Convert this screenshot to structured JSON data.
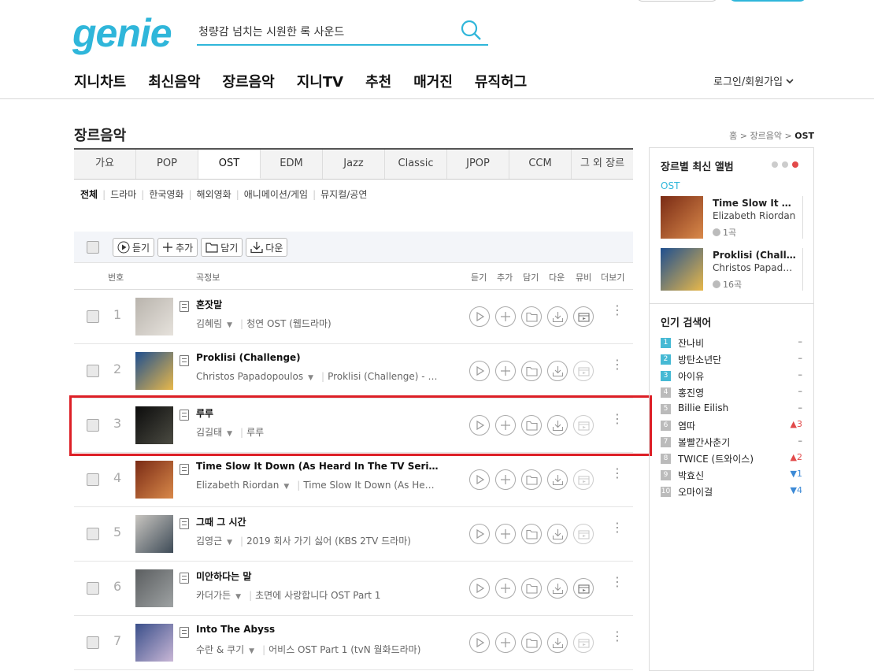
{
  "logo": "genie",
  "search": {
    "value": "청량감 넘치는 시원한 록 사운드"
  },
  "nav": [
    "지니차트",
    "최신음악",
    "장르음악",
    "지니TV",
    "추천",
    "매거진",
    "뮤직허그"
  ],
  "login": "로그인/회원가입",
  "page_title": "장르음악",
  "breadcrumb": {
    "home": "홈",
    "mid": "장르음악",
    "current": "OST"
  },
  "genre_tabs": [
    "가요",
    "POP",
    "OST",
    "EDM",
    "Jazz",
    "Classic",
    "JPOP",
    "CCM",
    "그 외 장르"
  ],
  "active_tab": "OST",
  "subtabs": [
    "전체",
    "드라마",
    "한국영화",
    "해외영화",
    "애니메이션/게임",
    "뮤지컬/공연"
  ],
  "toolbar": {
    "play": "듣기",
    "add": "추가",
    "save": "담기",
    "download": "다운"
  },
  "columns": {
    "num": "번호",
    "info": "곡정보",
    "play": "듣기",
    "add": "추가",
    "save": "담기",
    "down": "다운",
    "mv": "뮤비",
    "more": "더보기"
  },
  "songs": [
    {
      "rank": "1",
      "title": "혼잣말",
      "artist": "김혜림",
      "album": "청연 OST (웹드라마)",
      "mv": true,
      "colors": [
        "#b9b4ad",
        "#e6e2dc"
      ]
    },
    {
      "rank": "2",
      "title": "Proklisi (Challenge)",
      "artist": "Christos Papadopoulos",
      "album": "Proklisi (Challenge) - Original Soundtrack",
      "mv": false,
      "colors": [
        "#1f4f8f",
        "#e8b84a"
      ]
    },
    {
      "rank": "3",
      "title": "루루",
      "artist": "김길태",
      "album": "루루",
      "mv": false,
      "colors": [
        "#0c0c0c",
        "#4b4b42"
      ]
    },
    {
      "rank": "4",
      "title": "Time Slow It Down (As Heard In The TV Series 'Fruits Basket')",
      "artist": "Elizabeth Riordan",
      "album": "Time Slow It Down (As Heard In The TV Series)",
      "mv": false,
      "colors": [
        "#7a2b15",
        "#d9894a"
      ]
    },
    {
      "rank": "5",
      "title": "그때 그 시간",
      "artist": "김영근",
      "album": "2019 회사 가기 싫어 (KBS 2TV 드라마)",
      "mv": false,
      "colors": [
        "#c8c5c0",
        "#3e4b57"
      ]
    },
    {
      "rank": "6",
      "title": "미안하다는 말",
      "artist": "카더가든",
      "album": "초면에 사랑합니다 OST Part 1",
      "mv": true,
      "colors": [
        "#5b5e60",
        "#9ea2a3"
      ]
    },
    {
      "rank": "7",
      "title": "Into The Abyss",
      "artist": "수란 & 쿠기",
      "album": "어비스 OST Part 1 (tvN 월화드라마)",
      "mv": false,
      "colors": [
        "#3a4f8a",
        "#c9b7d6"
      ]
    }
  ],
  "sidebar": {
    "title": "장르별 최신 앨범",
    "genre": "OST",
    "albums": [
      {
        "title": "Time Slow It Down",
        "artist": "Elizabeth Riordan",
        "count": "1곡",
        "colors": [
          "#7a2b15",
          "#d9894a"
        ]
      },
      {
        "title": "Proklisi (Challenge)",
        "artist": "Christos Papadopoulos",
        "count": "16곡",
        "colors": [
          "#1f4f8f",
          "#e8b84a"
        ]
      }
    ],
    "hot_title": "인기 검색어",
    "hot": [
      {
        "rank": "1",
        "name": "잔나비",
        "change": "–",
        "dir": "same"
      },
      {
        "rank": "2",
        "name": "방탄소년단",
        "change": "–",
        "dir": "same"
      },
      {
        "rank": "3",
        "name": "아이유",
        "change": "–",
        "dir": "same"
      },
      {
        "rank": "4",
        "name": "홍진영",
        "change": "–",
        "dir": "same"
      },
      {
        "rank": "5",
        "name": "Billie Eilish",
        "change": "–",
        "dir": "same"
      },
      {
        "rank": "6",
        "name": "염따",
        "change": "▲3",
        "dir": "up"
      },
      {
        "rank": "7",
        "name": "볼빨간사춘기",
        "change": "–",
        "dir": "same"
      },
      {
        "rank": "8",
        "name": "TWICE (트와이스)",
        "change": "▲2",
        "dir": "up"
      },
      {
        "rank": "9",
        "name": "박효신",
        "change": "▼1",
        "dir": "down"
      },
      {
        "rank": "10",
        "name": "오마이걸",
        "change": "▼4",
        "dir": "down"
      }
    ]
  },
  "colors": {
    "accent": "#2fb6da",
    "highlight": "#dd1f26"
  }
}
